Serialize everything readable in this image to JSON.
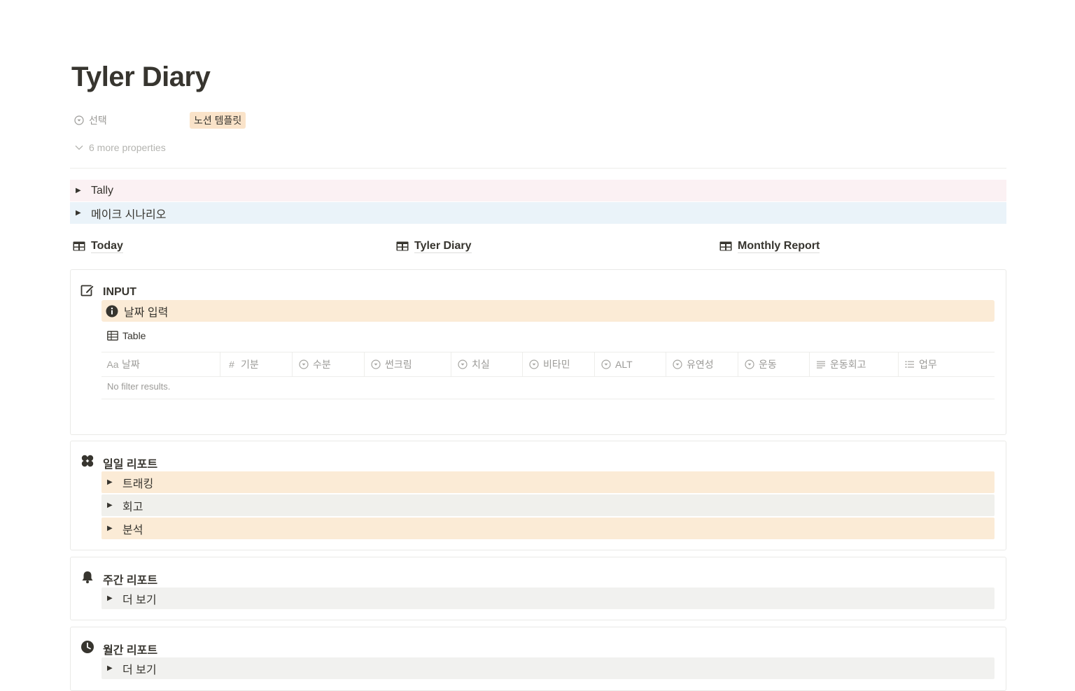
{
  "page": {
    "title": "Tyler Diary",
    "property": {
      "label": "선택",
      "value": "노션 템플릿",
      "tag_color": "#fae3c9"
    },
    "more_properties": "6 more properties"
  },
  "toggles": [
    {
      "label": "Tally",
      "bg": "#fbf1f3"
    },
    {
      "label": "메이크 시나리오",
      "bg": "#eaf3f9"
    }
  ],
  "links": [
    {
      "label": "Today"
    },
    {
      "label": "Tyler Diary"
    },
    {
      "label": "Monthly Report"
    }
  ],
  "input_card": {
    "title": "INPUT",
    "callout": "날짜 입력",
    "view_tab": "Table",
    "columns": [
      {
        "icon": "Aa",
        "label": "날짜"
      },
      {
        "icon": "#",
        "label": "기분"
      },
      {
        "icon": "select",
        "label": "수분"
      },
      {
        "icon": "select",
        "label": "썬크림"
      },
      {
        "icon": "select",
        "label": "치실"
      },
      {
        "icon": "select",
        "label": "비타민"
      },
      {
        "icon": "select",
        "label": "ALT"
      },
      {
        "icon": "select",
        "label": "유연성"
      },
      {
        "icon": "select",
        "label": "운동"
      },
      {
        "icon": "text",
        "label": "운동회고"
      },
      {
        "icon": "list",
        "label": "업무"
      }
    ],
    "empty_text": "No filter results."
  },
  "daily_card": {
    "title": "일일 리포트",
    "items": [
      {
        "label": "트래킹",
        "bg": "#fbebd6"
      },
      {
        "label": "회고",
        "bg": "#f0f0ec"
      },
      {
        "label": "분석",
        "bg": "#fbebd6"
      }
    ]
  },
  "weekly_card": {
    "title": "주간 리포트",
    "item": "더 보기"
  },
  "monthly_card": {
    "title": "월간 리포트",
    "item": "더 보기"
  },
  "colors": {
    "callout_bg": "#fbebd6",
    "grey_band": "#f1f1ef"
  }
}
